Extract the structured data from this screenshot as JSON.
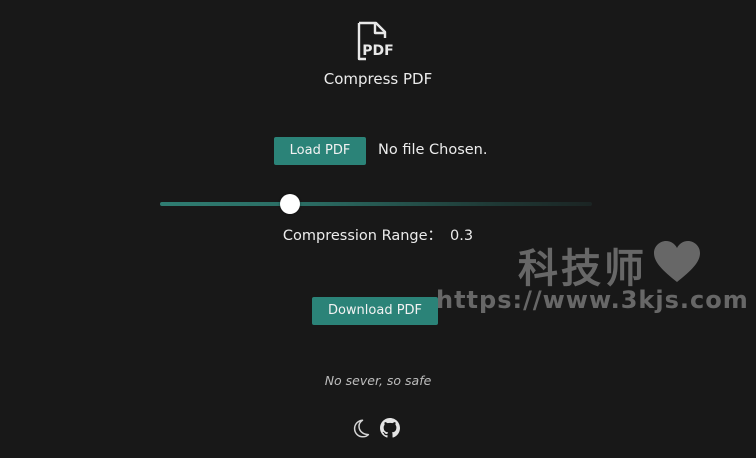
{
  "header": {
    "title": "Compress PDF",
    "icon": "pdf-file-icon",
    "icon_text": "PDF"
  },
  "load": {
    "button_label": "Load PDF",
    "file_status": "No file Chosen."
  },
  "compression": {
    "label": "Compression Range：",
    "value": "0.3",
    "slider_fraction": 0.3
  },
  "download": {
    "button_label": "Download PDF"
  },
  "tagline": "No sever, so safe",
  "footer": {
    "icons": [
      "moon-icon",
      "github-icon"
    ]
  },
  "watermark": {
    "chinese": "科技师",
    "url": "https://www.3kjs.com",
    "icon": "heart-icon"
  },
  "colors": {
    "background": "#181818",
    "accent": "#2b8378",
    "text": "#ececec"
  }
}
